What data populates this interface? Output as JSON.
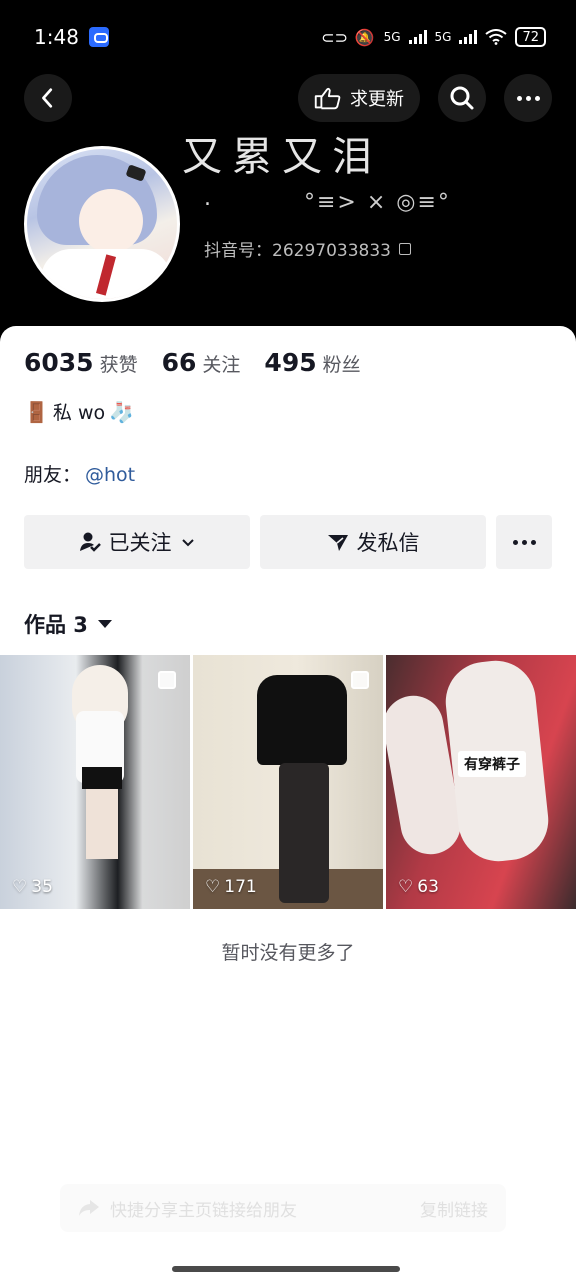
{
  "status_bar": {
    "time": "1:48",
    "network1": "5G",
    "network2": "5G",
    "battery": "72"
  },
  "nav": {
    "update_label": "求更新"
  },
  "profile": {
    "nickname": "又累又泪",
    "dot_text": ".",
    "emoticon": "°≡> × ◎≡°",
    "douyin_id": "抖音号：26297033833"
  },
  "stats": {
    "likes_num": "6035",
    "likes_label": "获赞",
    "following_num": "66",
    "following_label": "关注",
    "fans_num": "495",
    "fans_label": "粉丝"
  },
  "bio": {
    "emoji_left": "🚪",
    "text": "私 wo",
    "emoji_right": "🧦"
  },
  "friends": {
    "label": "朋友：",
    "link": "@hot"
  },
  "actions": {
    "followed": "已关注",
    "message": "发私信"
  },
  "works_tab": {
    "label": "作品 3"
  },
  "videos": [
    {
      "likes": "35"
    },
    {
      "likes": "171"
    },
    {
      "likes": "63",
      "overlay": "有穿裤子"
    }
  ],
  "no_more_text": "暂时没有更多了",
  "share_bar": {
    "text": "快捷分享主页链接给朋友",
    "copy_link": "复制链接"
  }
}
